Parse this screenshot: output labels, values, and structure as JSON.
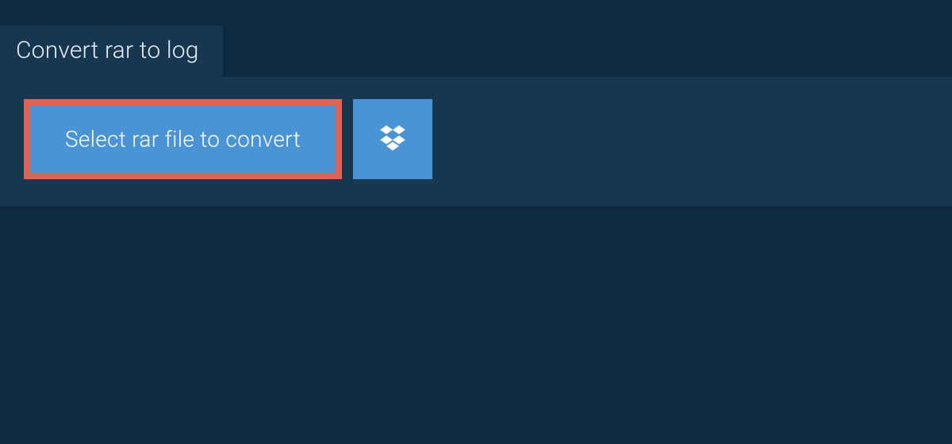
{
  "header": {
    "tab_label": "Convert rar to log"
  },
  "actions": {
    "select_file_label": "Select rar file to convert",
    "dropbox_icon": "dropbox-icon"
  },
  "colors": {
    "page_bg": "#0f2940",
    "panel_bg": "#173650",
    "button_bg": "#4a94d6",
    "highlight_border": "#e06354",
    "text_light": "#ffffff"
  }
}
